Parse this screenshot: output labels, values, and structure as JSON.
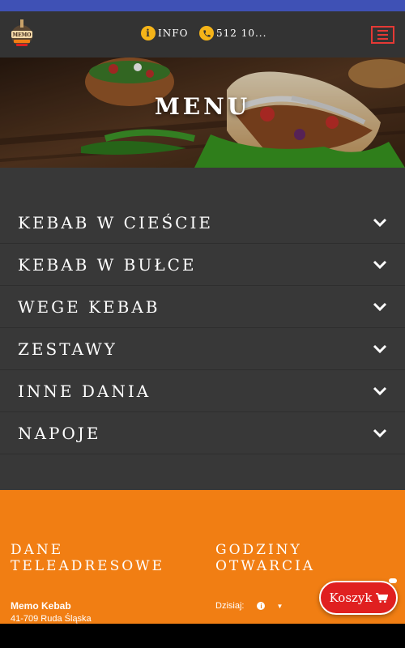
{
  "nav": {
    "logo_text": "MEMO",
    "info_label": "INFO",
    "phone_label": "512 10..."
  },
  "hero": {
    "title": "MENU"
  },
  "menu": {
    "items": [
      {
        "label": "KEBAB W CIEŚCIE"
      },
      {
        "label": "KEBAB W BUŁCE"
      },
      {
        "label": "WEGE KEBAB"
      },
      {
        "label": "ZESTAWY"
      },
      {
        "label": "INNE DANIA"
      },
      {
        "label": "NAPOJE"
      }
    ]
  },
  "footer": {
    "contact_heading_1": "DANE",
    "contact_heading_2": "TELEADRESOWE",
    "hours_heading_1": "GODZINY",
    "hours_heading_2": "OTWARCIA",
    "business_name": "Memo Kebab",
    "address": "41-709 Ruda Śląska",
    "today_label": "Dzisiaj:"
  },
  "cart": {
    "label": "Koszyk"
  },
  "colors": {
    "status_bar": "#3f51b5",
    "nav_bg": "#333333",
    "menu_bg": "#383838",
    "footer_bg": "#f17e13",
    "accent_red": "#e02020",
    "icon_yellow": "#f5b418"
  }
}
